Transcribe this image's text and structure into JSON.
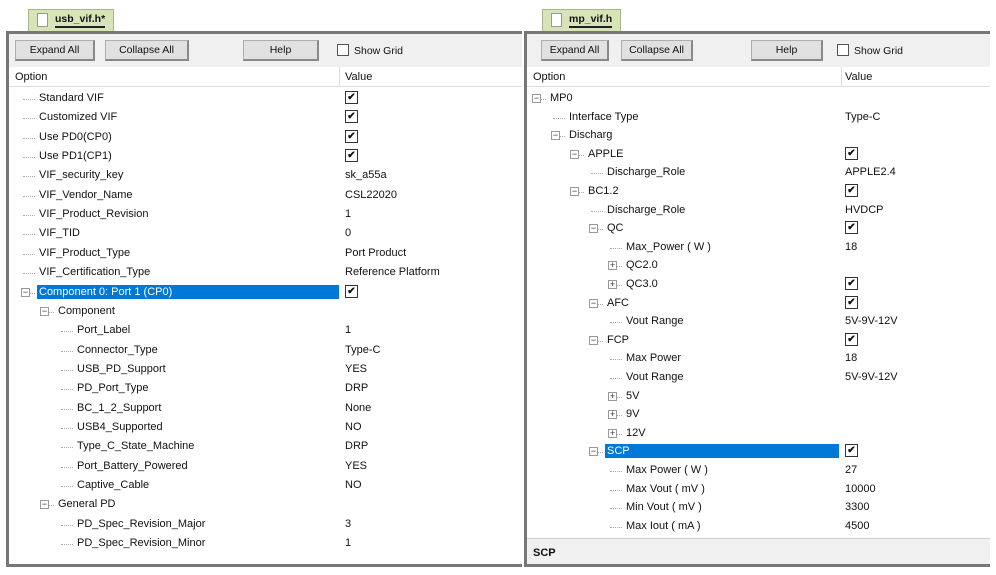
{
  "toolbar": {
    "expand_all": "Expand All",
    "collapse_all": "Collapse All",
    "help": "Help",
    "show_grid": "Show Grid"
  },
  "columns": {
    "option": "Option",
    "value": "Value"
  },
  "left": {
    "tab": "usb_vif.h*",
    "rows": [
      {
        "label": "Standard VIF",
        "level": 0,
        "check": true
      },
      {
        "label": "Customized VIF",
        "level": 0,
        "check": true
      },
      {
        "label": "Use PD0(CP0)",
        "level": 0,
        "check": true
      },
      {
        "label": "Use PD1(CP1)",
        "level": 0,
        "check": true
      },
      {
        "label": "VIF_security_key",
        "level": 0,
        "value": "sk_a55a"
      },
      {
        "label": "VIF_Vendor_Name",
        "level": 0,
        "value": "CSL22020"
      },
      {
        "label": "VIF_Product_Revision",
        "level": 0,
        "value": "1"
      },
      {
        "label": "VIF_TID",
        "level": 0,
        "value": "0"
      },
      {
        "label": "VIF_Product_Type",
        "level": 0,
        "value": "Port Product"
      },
      {
        "label": "VIF_Certification_Type",
        "level": 0,
        "value": "Reference Platform"
      },
      {
        "label": "Component 0: Port 1 (CP0)",
        "level": 0,
        "exp": "-",
        "check": true,
        "selected": true
      },
      {
        "label": "Component",
        "level": 1,
        "exp": "-"
      },
      {
        "label": "Port_Label",
        "level": 2,
        "value": "1"
      },
      {
        "label": "Connector_Type",
        "level": 2,
        "value": "Type-C"
      },
      {
        "label": "USB_PD_Support",
        "level": 2,
        "value": "YES"
      },
      {
        "label": "PD_Port_Type",
        "level": 2,
        "value": "DRP"
      },
      {
        "label": "BC_1_2_Support",
        "level": 2,
        "value": "None"
      },
      {
        "label": "USB4_Supported",
        "level": 2,
        "value": "NO"
      },
      {
        "label": "Type_C_State_Machine",
        "level": 2,
        "value": "DRP"
      },
      {
        "label": "Port_Battery_Powered",
        "level": 2,
        "value": "YES"
      },
      {
        "label": "Captive_Cable",
        "level": 2,
        "value": "NO"
      },
      {
        "label": "General PD",
        "level": 1,
        "exp": "-"
      },
      {
        "label": "PD_Spec_Revision_Major",
        "level": 2,
        "value": "3"
      },
      {
        "label": "PD_Spec_Revision_Minor",
        "level": 2,
        "value": "1"
      }
    ]
  },
  "right": {
    "tab": "mp_vif.h",
    "status": "SCP",
    "rows": [
      {
        "label": "MP0",
        "level": 0,
        "exp": "-"
      },
      {
        "label": "Interface Type",
        "level": 1,
        "value": "Type-C"
      },
      {
        "label": "Discharg",
        "level": 1,
        "exp": "-"
      },
      {
        "label": "APPLE",
        "level": 2,
        "exp": "-",
        "check": true
      },
      {
        "label": "Discharge_Role",
        "level": 3,
        "value": "APPLE2.4"
      },
      {
        "label": "BC1.2",
        "level": 2,
        "exp": "-",
        "check": true
      },
      {
        "label": "Discharge_Role",
        "level": 3,
        "value": "HVDCP"
      },
      {
        "label": "QC",
        "level": 3,
        "exp": "-",
        "check": true
      },
      {
        "label": "Max_Power ( W )",
        "level": 4,
        "value": "18"
      },
      {
        "label": "QC2.0",
        "level": 4,
        "exp": "+"
      },
      {
        "label": "QC3.0",
        "level": 4,
        "exp": "+",
        "check": true
      },
      {
        "label": "AFC",
        "level": 3,
        "exp": "-",
        "check": true
      },
      {
        "label": "Vout Range",
        "level": 4,
        "value": "5V-9V-12V"
      },
      {
        "label": "FCP",
        "level": 3,
        "exp": "-",
        "check": true
      },
      {
        "label": "Max Power",
        "level": 4,
        "value": "18"
      },
      {
        "label": "Vout Range",
        "level": 4,
        "value": "5V-9V-12V"
      },
      {
        "label": "5V",
        "level": 4,
        "exp": "+"
      },
      {
        "label": "9V",
        "level": 4,
        "exp": "+"
      },
      {
        "label": "12V",
        "level": 4,
        "exp": "+"
      },
      {
        "label": "SCP",
        "level": 3,
        "exp": "-",
        "check": true,
        "selected": true
      },
      {
        "label": "Max Power ( W )",
        "level": 4,
        "value": "27"
      },
      {
        "label": "Max Vout ( mV )",
        "level": 4,
        "value": "10000"
      },
      {
        "label": "Min Vout ( mV )",
        "level": 4,
        "value": "3300"
      },
      {
        "label": "Max Iout ( mA )",
        "level": 4,
        "value": "4500"
      }
    ]
  }
}
